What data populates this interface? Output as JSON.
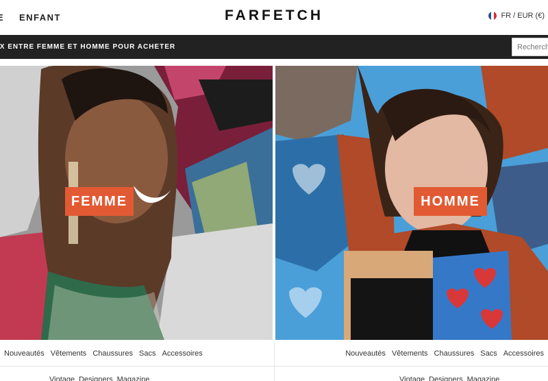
{
  "header": {
    "nav_edge": "E",
    "nav_item": "ENFANT",
    "logo": "FARFETCH",
    "locale": "FR / EUR (€)"
  },
  "banner": {
    "text": "IX ENTRE FEMME ET HOMME POUR ACHETER",
    "search_placeholder": "Recherche"
  },
  "panels": {
    "women": {
      "label": "FEMME"
    },
    "men": {
      "label": "HOMME"
    }
  },
  "women_categories": [
    "Nouveautés",
    "Vêtements",
    "Chaussures",
    "Sacs",
    "Accessoires"
  ],
  "men_categories": [
    "Nouveautés",
    "Vêtements",
    "Chaussures",
    "Sacs",
    "Accessoires"
  ],
  "women_secondary": [
    "Vintage",
    "Designers",
    "Magazine"
  ],
  "men_secondary": [
    "Vintage",
    "Designers",
    "Magazine"
  ],
  "colors": {
    "label_bg": "#e25a33",
    "bar_bg": "#222222"
  },
  "icons": {
    "flag": "france-flag-icon"
  }
}
